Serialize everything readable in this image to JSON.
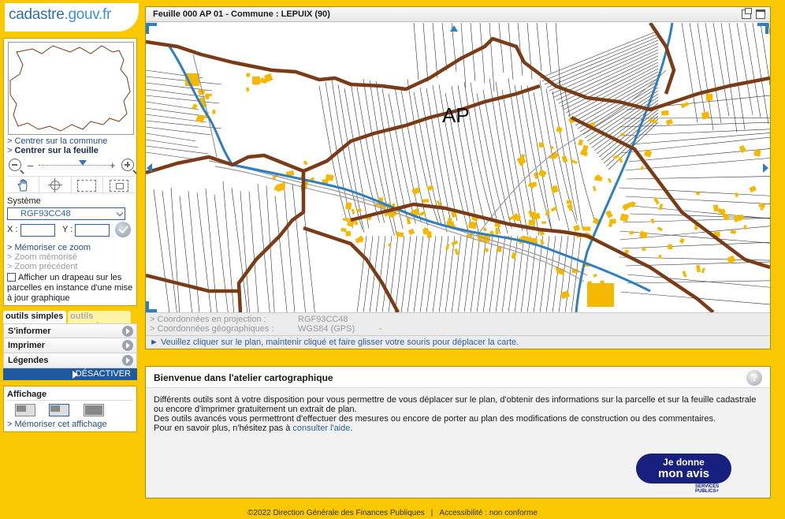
{
  "logo": {
    "name": "cadastre",
    "tld": ".gouv.fr"
  },
  "nav": {
    "links": {
      "center_commune": "Centrer sur la commune",
      "center_feuille": "Centrer sur la feuille"
    },
    "zoom": {
      "minus": "–",
      "plus": "+",
      "level": 0.62
    },
    "systeme_label": "Système",
    "systeme_value": "RGF93CC48",
    "x_label": "X :",
    "y_label": "Y :",
    "memo_zoom": "Mémoriser ce zoom",
    "zoom_memo": "Zoom mémorisé",
    "zoom_prev": "Zoom précédent",
    "flag_text": "Afficher un drapeau sur les parcelles en instance d'une mise à jour graphique",
    "arrow": ">"
  },
  "tools": {
    "tab_simple": "outils simples",
    "tab_advanced": "outils avancés",
    "items": [
      "S'informer",
      "Imprimer",
      "Légendes"
    ],
    "deactivate": "DÉSACTIVER"
  },
  "affichage": {
    "title": "Affichage",
    "memo": "Mémoriser cet affichage"
  },
  "map": {
    "title": "Feuille 000 AP 01 - Commune : LEPUIX (90)",
    "section_label": "AP",
    "coord_proj_label": "Coordonnées en projection :",
    "coord_proj_value": "RGF93CC48",
    "coord_geo_label": "Coordonnées géographiques :",
    "coord_geo_value": "WGS84 (GPS)",
    "coord_geo_extra": "-",
    "hint": "► Veuillez cliquer sur le plan, maintenir cliqué et faire glisser votre souris pour déplacer la carte.",
    "colors": {
      "boundary": "#7a3b17",
      "river": "#2f7fc0",
      "building": "#f5b800"
    }
  },
  "welcome": {
    "title": "Bienvenue dans l'atelier cartographique",
    "help": "?",
    "p1": "Différents outils sont à votre disposition pour vous permettre de vous déplacer sur le plan, d'obtenir des informations sur la parcelle et sur la feuille cadastrale ou encore d'imprimer gratuitement un extrait de plan.",
    "p2": "Des outils avancés vous permettront d'effectuer des mesures ou encore de porter au plan des modifications de construction ou des commentaires.",
    "p3_prefix": "Pour en savoir plus, n'hésitez pas à",
    "p3_link": "consulter l'aide",
    "p3_suffix": ".",
    "avis_line1": "Je donne",
    "avis_line2": "mon avis",
    "services_line1": "SERVICES",
    "services_line2": "PUBLICS+"
  },
  "footer": {
    "copyright": "©2022 Direction Générale des Finances Publiques",
    "separator": "|",
    "accessibility": "Accessibilité : non conforme"
  }
}
